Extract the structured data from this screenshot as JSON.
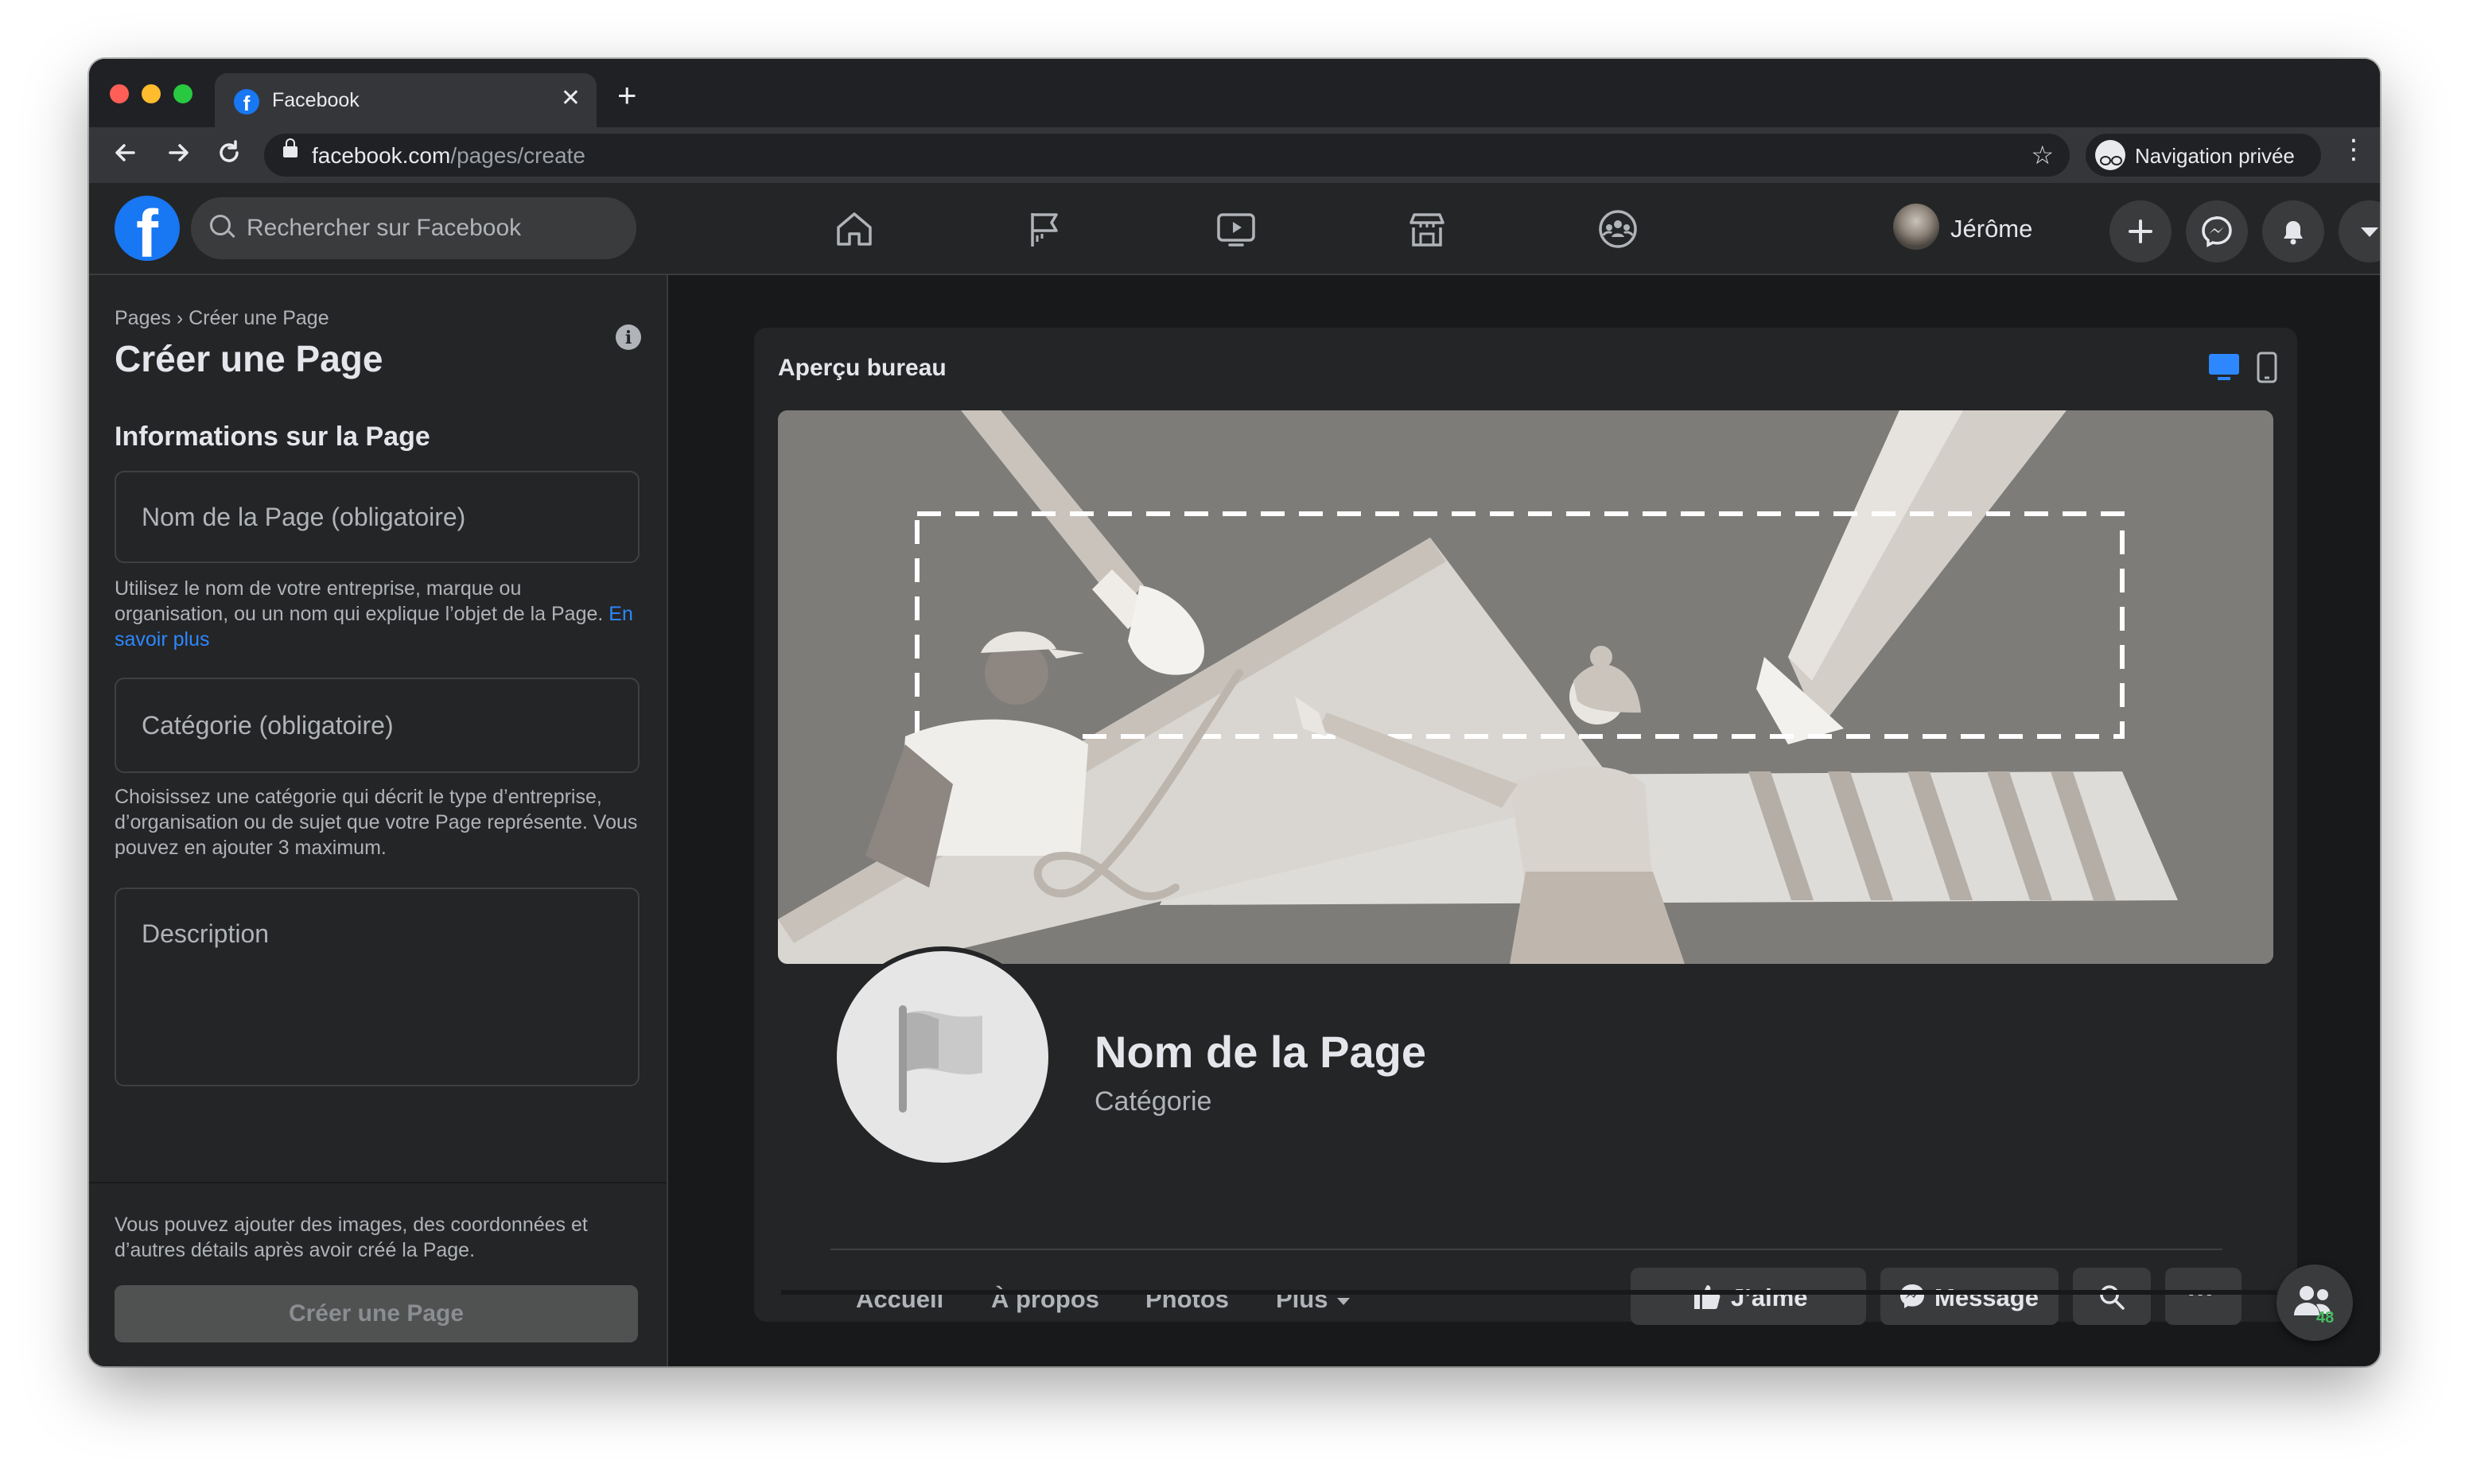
{
  "browser": {
    "tab_title": "Facebook",
    "tab_close": "✕",
    "new_tab": "+",
    "url_domain": "facebook.com",
    "url_path": "/pages/create",
    "incognito_label": "Navigation privée",
    "menu": "⋮"
  },
  "fb_nav": {
    "logo": "f",
    "search_placeholder": "Rechercher sur Facebook",
    "user_name": "Jérôme",
    "contacts_count": "48"
  },
  "left_panel": {
    "breadcrumb": "Pages › Créer une Page",
    "title": "Créer une Page",
    "info_icon": "i",
    "section_title": "Informations sur la Page",
    "name_placeholder": "Nom de la Page (obligatoire)",
    "name_help": "Utilisez le nom de votre entreprise, marque ou organisation, ou un nom qui explique l’objet de la Page.",
    "name_help_link": "En savoir plus",
    "category_placeholder": "Catégorie (obligatoire)",
    "category_help": "Choisissez une catégorie qui décrit le type d’entreprise, d’organisation ou de sujet que votre Page représente. Vous pouvez en ajouter 3 maximum.",
    "description_placeholder": "Description",
    "footnote": "Vous pouvez ajouter des images, des coordonnées et d’autres détails après avoir créé la Page.",
    "create_button": "Créer une Page"
  },
  "preview": {
    "title": "Aperçu bureau",
    "page_name": "Nom de la Page",
    "page_category": "Catégorie",
    "tabs": [
      "Accueil",
      "À propos",
      "Photos",
      "Plus"
    ],
    "like_button": "J’aime",
    "message_button": "Message",
    "more_button": "···"
  },
  "colors": {
    "accent": "#1877f2",
    "link": "#2d88ff",
    "background": "#18191a",
    "surface": "#242526"
  }
}
